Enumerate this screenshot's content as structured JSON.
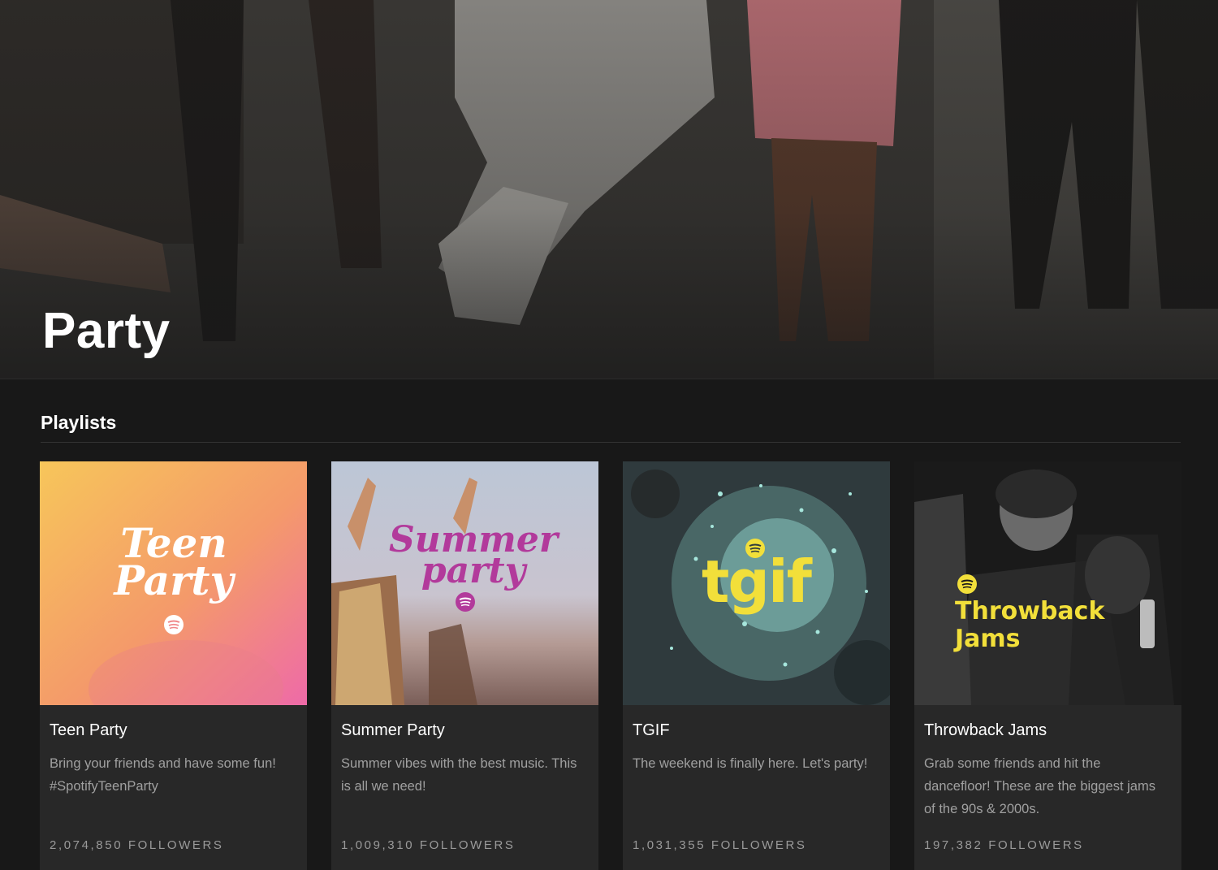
{
  "page": {
    "title": "Party",
    "section_title": "Playlists"
  },
  "colors": {
    "background": "#181818",
    "card": "#282828",
    "text_primary": "#ffffff",
    "text_secondary": "#a0a0a0"
  },
  "playlists": [
    {
      "title": "Teen Party",
      "description": "Bring your friends and have some fun! #SpotifyTeenParty",
      "followers": "2,074,850 FOLLOWERS",
      "cover_text": [
        "Teen",
        "Party"
      ],
      "cover_icon": "spotify-icon"
    },
    {
      "title": "Summer Party",
      "description": "Summer vibes with the best music. This is all we need!",
      "followers": "1,009,310 FOLLOWERS",
      "cover_text": [
        "Summer",
        "party"
      ],
      "cover_icon": "spotify-icon"
    },
    {
      "title": "TGIF",
      "description": "The weekend is finally here. Let's party!",
      "followers": "1,031,355 FOLLOWERS",
      "cover_text": [
        "tgif"
      ],
      "cover_icon": "spotify-icon"
    },
    {
      "title": "Throwback Jams",
      "description": "Grab some friends and hit the dancefloor! These are the biggest jams of the 90s & 2000s.",
      "followers": "197,382 FOLLOWERS",
      "cover_text": [
        "Throwback",
        "Jams"
      ],
      "cover_icon": "spotify-icon"
    }
  ]
}
